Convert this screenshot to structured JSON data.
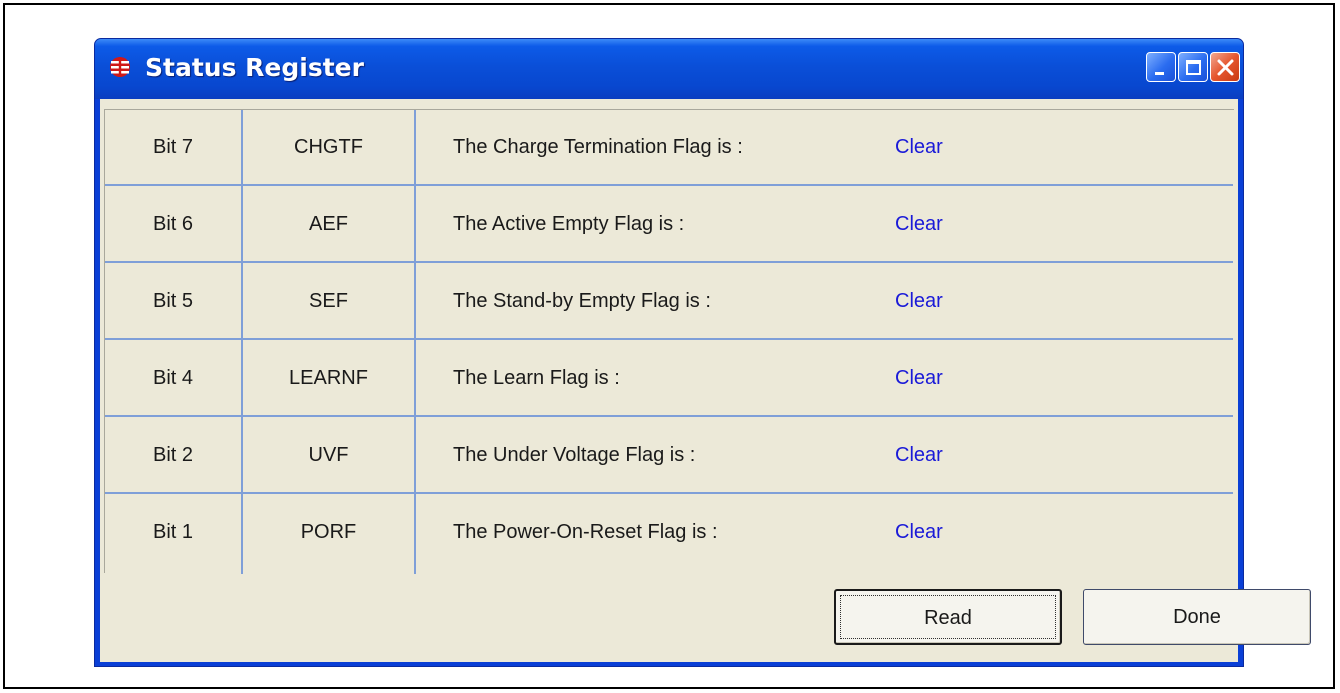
{
  "window": {
    "title": "Status Register",
    "icon": "app-logo-icon",
    "title_buttons": [
      "minimize-icon",
      "maximize-icon",
      "close-icon"
    ]
  },
  "rows": [
    {
      "bit": "Bit 7",
      "name": "CHGTF",
      "description": "The Charge Termination Flag is :",
      "status": "Clear"
    },
    {
      "bit": "Bit 6",
      "name": "AEF",
      "description": "The Active Empty Flag  is :",
      "status": "Clear"
    },
    {
      "bit": "Bit 5",
      "name": "SEF",
      "description": "The Stand-by Empty Flag  is :",
      "status": "Clear"
    },
    {
      "bit": "Bit 4",
      "name": "LEARNF",
      "description": "The Learn Flag is :",
      "status": "Clear"
    },
    {
      "bit": "Bit 2",
      "name": "UVF",
      "description": "The Under Voltage Flag is :",
      "status": "Clear"
    },
    {
      "bit": "Bit 1",
      "name": "PORF",
      "description": "The Power-On-Reset Flag is :",
      "status": "Clear"
    }
  ],
  "buttons": {
    "read_label": "Read",
    "done_label": "Done"
  },
  "colors": {
    "titlebar": "#0a4fd8",
    "status_text": "#1a1ad8",
    "grid_lines": "#7f9fd8",
    "client_bg": "#ece9d8"
  }
}
